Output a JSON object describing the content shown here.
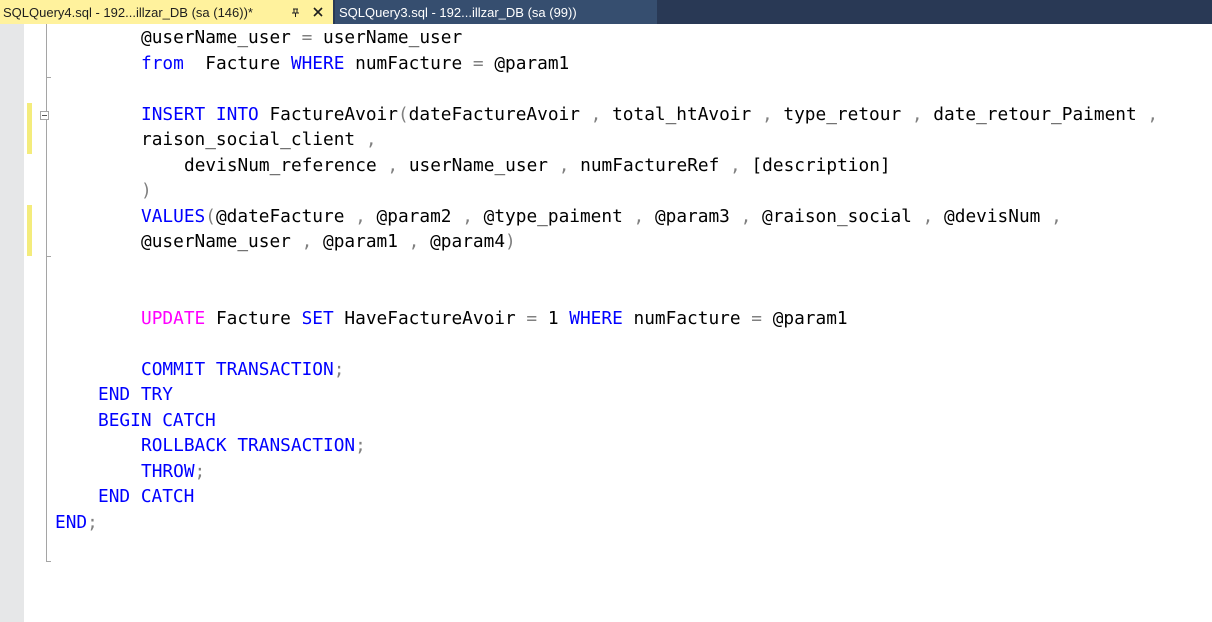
{
  "tabs": [
    {
      "label": "SQLQuery4.sql - 192...illzar_DB (sa (146))*",
      "active": true,
      "pin_icon": "pin-icon",
      "close_icon": "close-icon"
    },
    {
      "label": "SQLQuery3.sql - 192...illzar_DB (sa (99))",
      "active": false
    }
  ],
  "colors": {
    "keyword": "#0000ff",
    "function_keyword": "#ff00ff",
    "operator": "#808080",
    "identifier": "#000000",
    "active_tab": "#fff29d",
    "tabstrip": "#293955",
    "change_marker": "#f4ec7c"
  },
  "editor": {
    "lines": [
      {
        "indent": 2,
        "tokens": [
          [
            "id",
            "@userName_user"
          ],
          [
            "op",
            " = "
          ],
          [
            "id",
            "userName_user"
          ]
        ]
      },
      {
        "indent": 2,
        "tokens": [
          [
            "kw",
            "from"
          ],
          [
            "id",
            "  Facture "
          ],
          [
            "kw",
            "WHERE"
          ],
          [
            "id",
            " numFacture "
          ],
          [
            "op",
            "="
          ],
          [
            "id",
            " @param1"
          ]
        ]
      },
      {
        "indent": 0,
        "tokens": []
      },
      {
        "indent": 2,
        "tokens": [
          [
            "kw",
            "INSERT INTO"
          ],
          [
            "id",
            " FactureAvoir"
          ],
          [
            "op",
            "("
          ],
          [
            "id",
            "dateFactureAvoir "
          ],
          [
            "op",
            ","
          ],
          [
            "id",
            " total_htAvoir "
          ],
          [
            "op",
            ","
          ],
          [
            "id",
            " type_retour "
          ],
          [
            "op",
            ","
          ],
          [
            "id",
            " date_retour_Paiment "
          ],
          [
            "op",
            ","
          ]
        ]
      },
      {
        "indent": 2,
        "tokens": [
          [
            "id",
            "raison_social_client "
          ],
          [
            "op",
            ","
          ]
        ]
      },
      {
        "indent": 3,
        "tokens": [
          [
            "id",
            "devisNum_reference "
          ],
          [
            "op",
            ","
          ],
          [
            "id",
            " userName_user "
          ],
          [
            "op",
            ","
          ],
          [
            "id",
            " numFactureRef "
          ],
          [
            "op",
            ","
          ],
          [
            "id",
            " [description]"
          ]
        ]
      },
      {
        "indent": 2,
        "tokens": [
          [
            "op",
            ")"
          ]
        ]
      },
      {
        "indent": 2,
        "tokens": [
          [
            "kw",
            "VALUES"
          ],
          [
            "op",
            "("
          ],
          [
            "id",
            "@dateFacture "
          ],
          [
            "op",
            ","
          ],
          [
            "id",
            " @param2 "
          ],
          [
            "op",
            ","
          ],
          [
            "id",
            " @type_paiment "
          ],
          [
            "op",
            ","
          ],
          [
            "id",
            " @param3 "
          ],
          [
            "op",
            ","
          ],
          [
            "id",
            " @raison_social "
          ],
          [
            "op",
            ","
          ],
          [
            "id",
            " @devisNum "
          ],
          [
            "op",
            ","
          ]
        ]
      },
      {
        "indent": 2,
        "tokens": [
          [
            "id",
            "@userName_user "
          ],
          [
            "op",
            ","
          ],
          [
            "id",
            " @param1 "
          ],
          [
            "op",
            ","
          ],
          [
            "id",
            " @param4"
          ],
          [
            "op",
            ")"
          ]
        ]
      },
      {
        "indent": 0,
        "tokens": []
      },
      {
        "indent": 0,
        "tokens": []
      },
      {
        "indent": 2,
        "tokens": [
          [
            "pink",
            "UPDATE"
          ],
          [
            "id",
            " Facture "
          ],
          [
            "kw",
            "SET"
          ],
          [
            "id",
            " HaveFactureAvoir "
          ],
          [
            "op",
            "="
          ],
          [
            "id",
            " 1 "
          ],
          [
            "kw",
            "WHERE"
          ],
          [
            "id",
            " numFacture "
          ],
          [
            "op",
            "="
          ],
          [
            "id",
            " @param1"
          ]
        ]
      },
      {
        "indent": 0,
        "tokens": []
      },
      {
        "indent": 2,
        "tokens": [
          [
            "kw",
            "COMMIT TRANSACTION"
          ],
          [
            "op",
            ";"
          ]
        ]
      },
      {
        "indent": 1,
        "tokens": [
          [
            "kw",
            "END TRY"
          ]
        ]
      },
      {
        "indent": 1,
        "tokens": [
          [
            "kw",
            "BEGIN CATCH"
          ]
        ]
      },
      {
        "indent": 2,
        "tokens": [
          [
            "kw",
            "ROLLBACK TRANSACTION"
          ],
          [
            "op",
            ";"
          ]
        ]
      },
      {
        "indent": 2,
        "tokens": [
          [
            "kw",
            "THROW"
          ],
          [
            "op",
            ";"
          ]
        ]
      },
      {
        "indent": 1,
        "tokens": [
          [
            "kw",
            "END CATCH"
          ]
        ]
      },
      {
        "indent": 0,
        "tokens": [
          [
            "kw",
            "END"
          ],
          [
            "op",
            ";"
          ]
        ]
      }
    ]
  }
}
